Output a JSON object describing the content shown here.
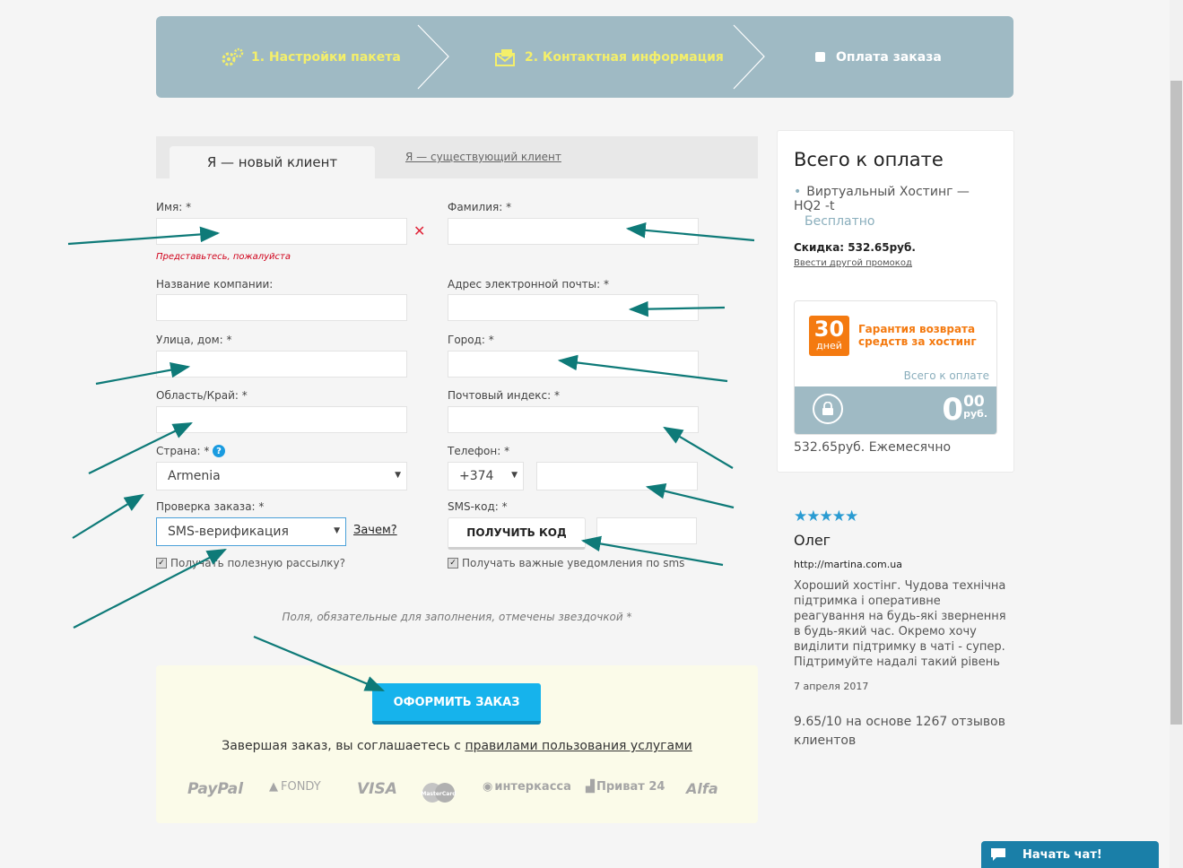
{
  "steps": [
    {
      "label": "1. Настройки пакета",
      "icon": "gears-icon"
    },
    {
      "label": "2. Контактная информация",
      "icon": "envelope-icon"
    },
    {
      "label": "Оплата заказа",
      "icon": "checkbox-icon"
    }
  ],
  "tabs": {
    "new_client": "Я — новый клиент",
    "existing_client": "Я — существующий клиент"
  },
  "form": {
    "first_name_label": "Имя: *",
    "first_name_error": "Представьтесь, пожалуйста",
    "last_name_label": "Фамилия: *",
    "company_label": "Название компании:",
    "email_label": "Адрес электронной почты: *",
    "street_label": "Улица, дом: *",
    "city_label": "Город: *",
    "region_label": "Область/Край: *",
    "zip_label": "Почтовый индекс: *",
    "country_label": "Страна: *",
    "country_value": "Armenia",
    "phone_label": "Телефон: *",
    "phone_code": "+374",
    "verify_label": "Проверка заказа: *",
    "verify_value": "SMS-верификация",
    "why_link": "Зачем?",
    "sms_label": "SMS-код: *",
    "get_code_button": "ПОЛУЧИТЬ КОД",
    "newsletter_label": "Получать полезную рассылку?",
    "sms_notify_label": "Получать важные уведомления по sms",
    "required_note": "Поля, обязательные для заполнения, отмечены звездочкой *"
  },
  "order": {
    "submit_button": "ОФОРМИТЬ ЗАКАЗ",
    "terms_prefix": "Завершая заказ, вы соглашаетесь с",
    "terms_link": "правилами пользования услугами",
    "payment_methods": [
      "PayPal",
      "FONDY",
      "VISA",
      "MasterCard",
      "интеркасса",
      "Приват 24",
      "Alfa"
    ]
  },
  "summary": {
    "title": "Всего к оплате",
    "item": "Виртуальный Хостинг — HQ2 -t",
    "item_price": "Бесплатно",
    "discount": "Скидка: 532.65руб.",
    "promo_link": "Ввести другой промокод",
    "guarantee_days": "30",
    "guarantee_days_label": "дней",
    "guarantee_text": "Гарантия возврата средств за хостинг",
    "total_label": "Всего к оплате",
    "total_int": "0",
    "total_dec": "00",
    "total_cur": "руб.",
    "monthly": "532.65руб. Ежемесячно"
  },
  "review": {
    "stars": "★★★★★",
    "name": "Олег",
    "url": "http://martina.com.ua",
    "text": "Хороший хостінг. Чудова технічна підтримка і оперативне реагування на будь-які звернення в будь-який час. Окремо хочу виділити підтримку в чаті - супер. Підтримуйте надалі такий рівень",
    "date": "7 апреля 2017",
    "rating": "9.65/10 на основе 1267 отзывов клиентов"
  },
  "chat": {
    "label": "Начать чат!"
  },
  "colors": {
    "accent": "#16b3ec",
    "steps_bg": "#9fbac4",
    "step_active": "#f4ef6a",
    "error": "#d0021b",
    "guarantee": "#f47a10",
    "arrow": "#0e7a78"
  }
}
